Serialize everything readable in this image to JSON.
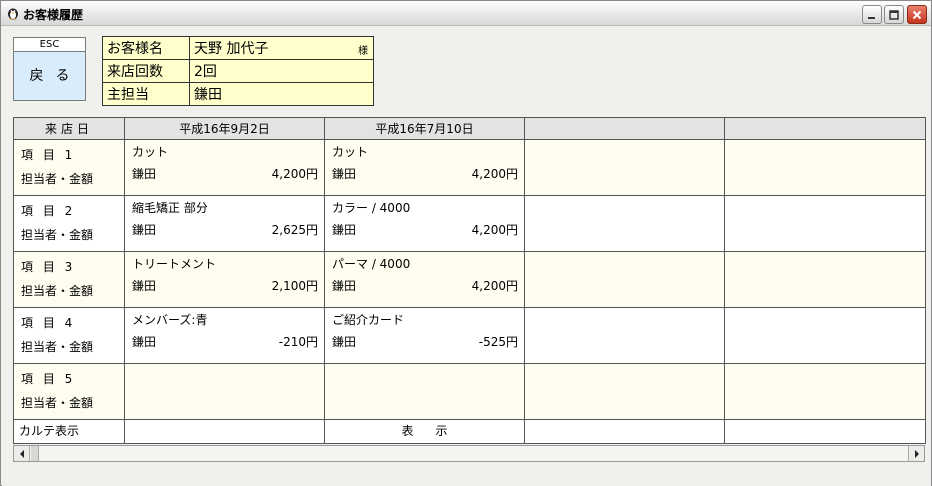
{
  "window": {
    "title": "お客様履歴",
    "icon": "penguin-icon",
    "controls": [
      "minimize-icon",
      "maximize-icon",
      "close-icon"
    ]
  },
  "esc_button": {
    "key_label": "ESC",
    "label": "戻る"
  },
  "customer": {
    "name_label": "お客様名",
    "name_value": "天野 加代子",
    "name_suffix": "様",
    "visits_label": "来店回数",
    "visits_value": "2回",
    "staff_label": "主担当",
    "staff_value": "鎌田"
  },
  "grid": {
    "header_label": "来店日",
    "dates": [
      "平成16年9月2日",
      "平成16年7月10日",
      "",
      ""
    ],
    "rows": [
      {
        "item_label": "項 目 1",
        "sub_label": "担当者・金額",
        "cells": [
          {
            "name": "カット",
            "staff": "鎌田",
            "amount": "4,200円"
          },
          {
            "name": "カット",
            "staff": "鎌田",
            "amount": "4,200円"
          }
        ]
      },
      {
        "item_label": "項 目 2",
        "sub_label": "担当者・金額",
        "cells": [
          {
            "name": "縮毛矯正 部分",
            "staff": "鎌田",
            "amount": "2,625円"
          },
          {
            "name": "カラー / 4000",
            "staff": "鎌田",
            "amount": "4,200円"
          }
        ]
      },
      {
        "item_label": "項 目 3",
        "sub_label": "担当者・金額",
        "cells": [
          {
            "name": "トリートメント",
            "staff": "鎌田",
            "amount": "2,100円"
          },
          {
            "name": "パーマ / 4000",
            "staff": "鎌田",
            "amount": "4,200円"
          }
        ]
      },
      {
        "item_label": "項 目 4",
        "sub_label": "担当者・金額",
        "cells": [
          {
            "name": "メンバーズ:青",
            "staff": "鎌田",
            "amount": "-210円"
          },
          {
            "name": "ご紹介カード",
            "staff": "鎌田",
            "amount": "-525円"
          }
        ]
      },
      {
        "item_label": "項 目 5",
        "sub_label": "担当者・金額",
        "cells": [
          {
            "name": "",
            "staff": "",
            "amount": ""
          },
          {
            "name": "",
            "staff": "",
            "amount": ""
          }
        ]
      }
    ],
    "footer_label": "カルテ表示",
    "footer_cells": [
      "",
      "表示",
      "",
      ""
    ]
  },
  "scrollbar": {
    "left_icon": "arrow-left-icon",
    "right_icon": "arrow-right-icon"
  }
}
